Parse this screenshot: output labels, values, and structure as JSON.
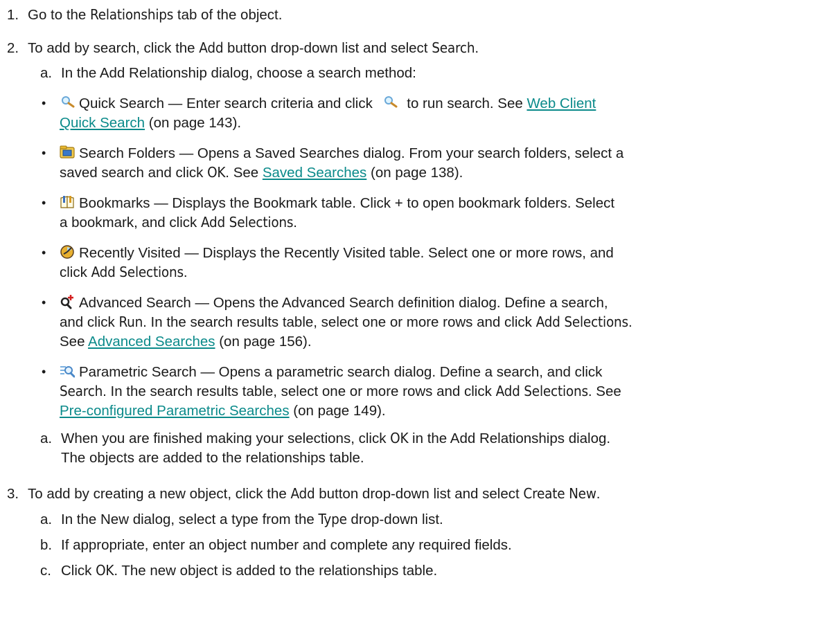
{
  "steps": [
    {
      "n": "1.",
      "pre": "Go to the ",
      "bold": "Relationships",
      "post": " tab of the object."
    },
    {
      "n": "2.",
      "pre": "To add by search, click the ",
      "bold1": "Add",
      "mid": " button drop-down list and select ",
      "bold2": "Search",
      "post": "."
    },
    {
      "n": "3.",
      "pre": " To add by creating a new object, click the ",
      "bold1": "Add",
      "mid": " button drop-down list and select ",
      "bold2": "Create New",
      "post": "."
    }
  ],
  "step2_sub": {
    "a_letter": "a.",
    "a_text": "In the Add Relationship dialog, choose a search method:",
    "final_letter": "a.",
    "final_line1_pre": "When you are finished making your selections, click ",
    "final_line1_bold": "OK",
    "final_line1_post": " in the Add Relationships dialog.",
    "final_line2": "The objects are added to the relationships table."
  },
  "bullets": {
    "quick": {
      "title": "Quick Search",
      "dash": " — Enter search criteria and click ",
      "after_icon": " to run search. See ",
      "link_line1": "Web Client ",
      "link_line2": "Quick Search",
      "ref": " (on page 143)."
    },
    "folders": {
      "title": "Search Folders",
      "line1": " — Opens a Saved Searches dialog. From your search folders, select a",
      "line2_pre": "saved search and click ",
      "line2_bold": "OK",
      "line2_mid": ". See ",
      "link": "Saved Searches",
      "ref": " (on page 138)."
    },
    "bookmarks": {
      "title": "Bookmarks",
      "line1": " — Displays the Bookmark table. Click + to open bookmark folders. Select",
      "line2_pre": "a bookmark, and click ",
      "line2_bold": "Add Selections",
      "line2_post": "."
    },
    "recent": {
      "title": "Recently Visited",
      "line1": " — Displays the Recently Visited table. Select one or more rows, and",
      "line2_pre": "click ",
      "line2_bold": "Add Selections",
      "line2_post": "."
    },
    "advanced": {
      "title": "Advanced Search",
      "line1": " — Opens the Advanced Search definition dialog. Define a search,",
      "line2_pre": "and click ",
      "line2_bold1": "Run",
      "line2_mid": ". In the search results table, select one or more rows and click ",
      "line2_bold2": "Add Selections",
      "line2_post": ".",
      "line3_pre": "See ",
      "link": "Advanced Searches",
      "ref": " (on page 156)."
    },
    "parametric": {
      "title": "Parametric Search",
      "line1": " — Opens a parametric search dialog. Define a search, and click",
      "line2_bold1": "Search",
      "line2_mid": ". In the search results table, select one or more rows and click ",
      "line2_bold2": "Add Selections",
      "line2_mid2": ". See",
      "link": "Pre-configured Parametric Searches",
      "ref": " (on page 149)."
    }
  },
  "step3_sub": [
    {
      "letter": "a.",
      "pre": "In the New dialog, select a type from the ",
      "bold": "Type",
      "post": " drop-down list."
    },
    {
      "letter": "b.",
      "pre": "If appropriate, enter an object number and complete any required fields.",
      "bold": "",
      "post": ""
    },
    {
      "letter": "c.",
      "pre": "Click ",
      "bold": "OK",
      "post": ". The new object is added to the relationships table."
    }
  ],
  "colors": {
    "text": "#1a1a1a",
    "link": "#0a8a8a"
  },
  "bullet_char": "•"
}
